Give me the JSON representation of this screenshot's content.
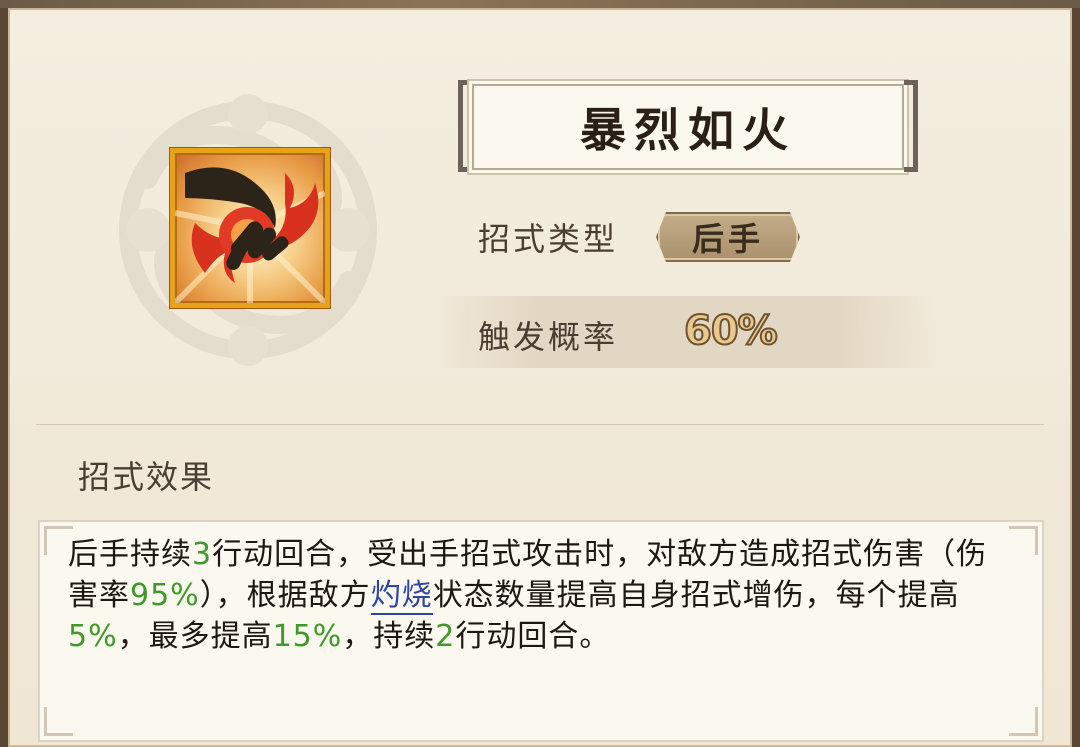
{
  "skill": {
    "name": "暴烈如火",
    "icon": "flame-fist-icon",
    "type_label": "招式类型",
    "type_value": "后手",
    "probability_label": "触发概率",
    "probability_value": "60%"
  },
  "effect": {
    "heading": "招式效果",
    "segments": {
      "s1": "后手持续",
      "n1": "3",
      "s2": "行动回合，受出手招式攻击时，对敌方造成招式伤害（伤害率",
      "n2": "95%",
      "s3": "），根据敌方",
      "kw": "灼烧",
      "s4": "状态数量提高自身招式增伤，每个提高",
      "n3": "5%",
      "s5": "，最多提高",
      "n4": "15%",
      "s6": "，持续",
      "n5": "2",
      "s7": "行动回合。"
    }
  },
  "colors": {
    "frame": "#5a4632",
    "panel": "#f1e9d8",
    "highlight_number": "#3f9a2a",
    "keyword": "#2f46a0",
    "icon_border": "#e8a21a"
  }
}
